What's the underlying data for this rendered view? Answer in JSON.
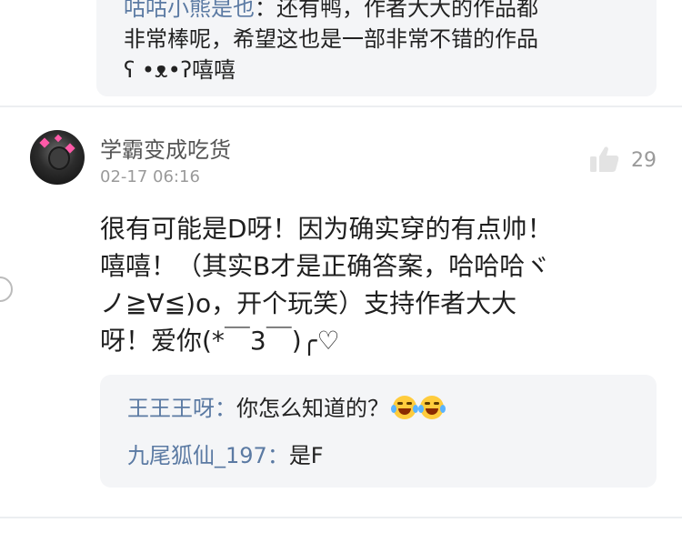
{
  "top_reply": {
    "author": "咕咕小熊是也",
    "lines": [
      "：还有鸭，作者大大的作品都",
      "非常棒呢，希望这也是一部非常不错的作品",
      "ʕ •ᴥ•ʔ嘻嘻"
    ]
  },
  "comment": {
    "username": "学霸变成吃货",
    "time": "02-17 06:16",
    "like_count": "29",
    "lines": [
      "很有可能是D呀！因为确实穿的有点帅！",
      "嘻嘻！（其实B才是正确答案，哈哈哈ヾ",
      "ノ≧∀≦)o，开个玩笑）支持作者大大",
      "呀！爱你(*￣3￣)╭♡"
    ],
    "replies": [
      {
        "author": "王王王呀",
        "text": "你怎么知道的？"
      },
      {
        "author": "九尾狐仙_197",
        "text": "是F"
      }
    ]
  },
  "icons": {
    "like": "thumbs-up-icon",
    "emoji": "laughing-tears-emoji"
  },
  "colors": {
    "reply_author": "#5b7aa3",
    "reply_bg": "#f4f5f7"
  }
}
